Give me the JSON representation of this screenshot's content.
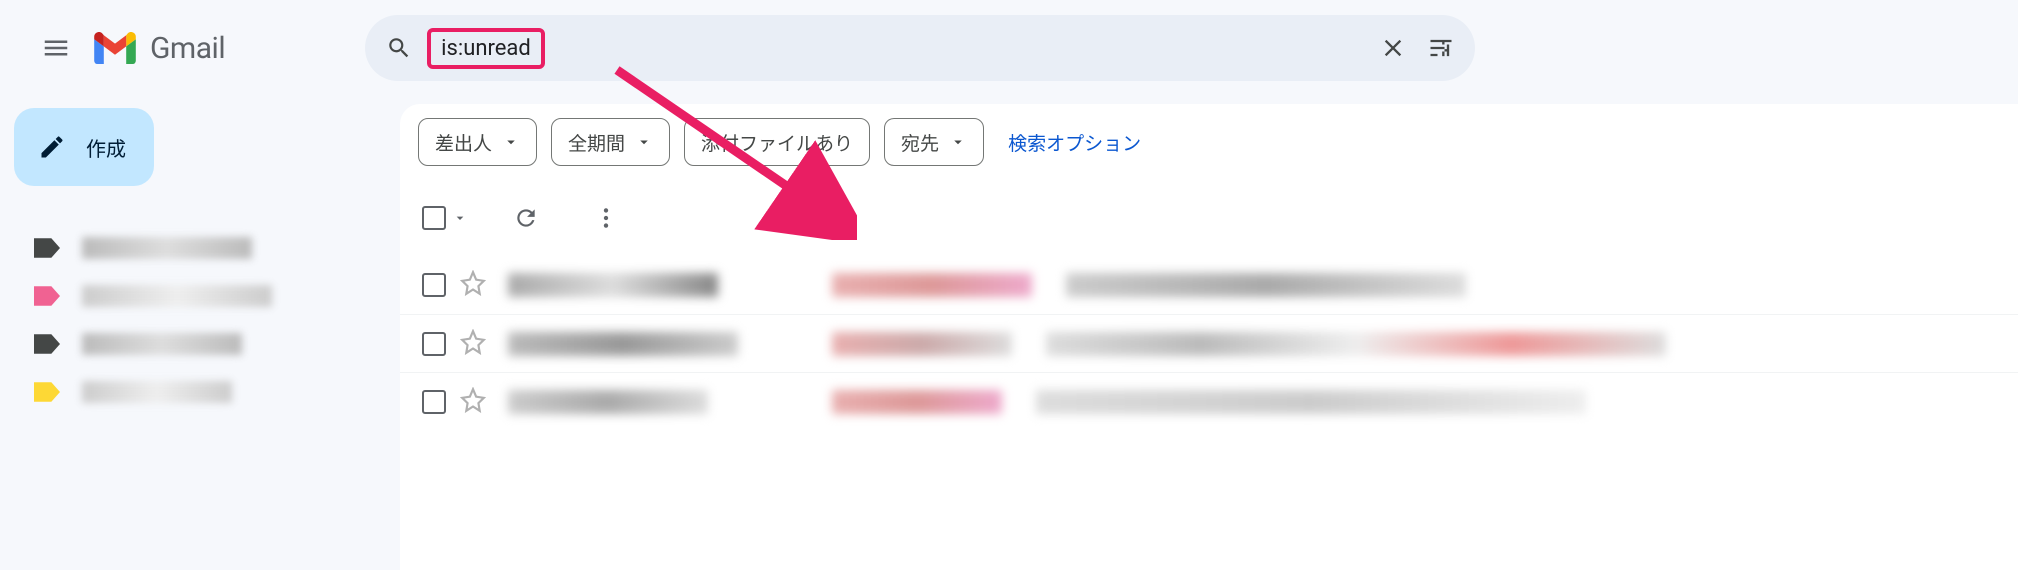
{
  "header": {
    "product_name": "Gmail",
    "search_value": "is:unread"
  },
  "sidebar": {
    "compose_label": "作成",
    "labels": [
      {
        "color": "#444746"
      },
      {
        "color": "#f06292"
      },
      {
        "color": "#444746"
      },
      {
        "color": "#fdd835"
      }
    ]
  },
  "chips": {
    "from": "差出人",
    "all_time": "全期間",
    "has_attachment": "添付ファイルあり",
    "to": "宛先",
    "search_options": "検索オプション"
  },
  "colors": {
    "accent_highlight": "#e91e63",
    "google_blue": "#1a73e8"
  }
}
